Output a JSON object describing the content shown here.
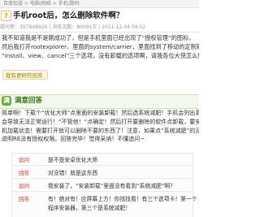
{
  "breadcrumb": "百度知道 > 电脑/网络 > 手机/数码",
  "question": {
    "icon_label": "?",
    "title": "手机root后，怎么删除软件啊？",
    "meta": "提问者：397848926 | 浏览次数：80091次 | 2011-12-04 09:52",
    "body_lines": [
      "我不知道我是不是刚成功了，但是手机里面已经出现了“授权管理”的图标，",
      "然后我打开rootexplorer，里面的system/carrier，里面找到了移动的定制软件，",
      "“install、view、cancel”三个选项，没有卸载的选项啊，请我各位大侠怎么删除？"
    ],
    "help_button": "我有更好的回答"
  },
  "answer": {
    "badge": "满",
    "title": "满意回答",
    "lines": [
      "简单啊！下载个“优化大师”点里面的安装卸载！然后选系统减肥！手机会列出系统软件，",
      "会导致无法正常运行！“不管他！“点确定！然后打开要删除的软件点卸载，要安装“优化大师”，",
      "机加载状态！需要打开就可以删除不要的东西了！注意，如果点“系统减肥”的没有，",
      "说明RE没有授权权限。回答完毕！觉得采纳！不懂追问~"
    ]
  },
  "followups": [
    {
      "tag": "追问",
      "lines": [
        "是不是安卓优化大师"
      ]
    },
    {
      "tag": "回答",
      "lines": [
        "对没错！就是这东西"
      ]
    },
    {
      "tag": "追问",
      "lines": [
        "我安装了，“安装卸载”里面没有看到“系统减肥”啊？"
      ]
    },
    {
      "tag": "回答",
      "lines": [
        "有！绝对有！应屏幕上方！你找找看！有三个选项卡！第一个",
        "程序安装器，第三个是系统减肥！"
      ]
    }
  ]
}
